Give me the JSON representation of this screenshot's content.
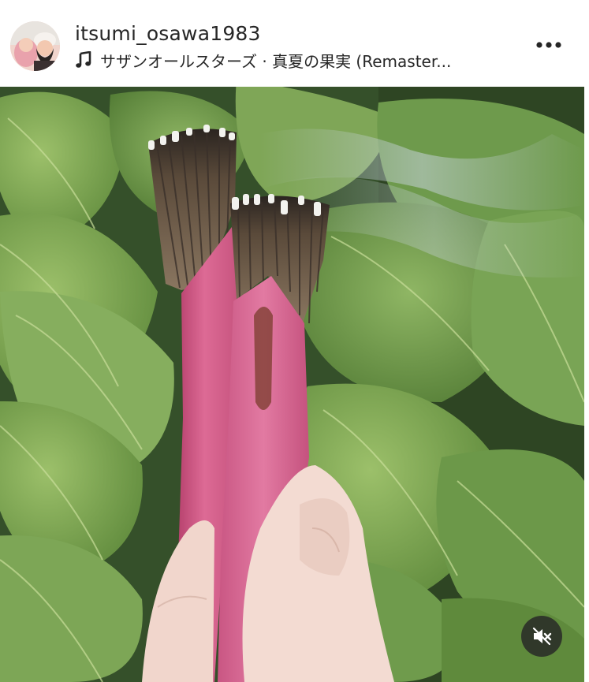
{
  "post": {
    "username": "itsumi_osawa1983",
    "music": {
      "icon": "music-note-icon",
      "text": "サザンオールスターズ · 真夏の果実 (Remaster..."
    },
    "more_icon": "more-options-icon",
    "mute_icon": "speaker-muted-icon"
  }
}
